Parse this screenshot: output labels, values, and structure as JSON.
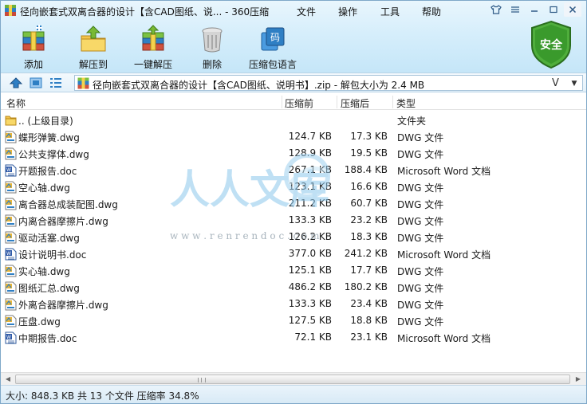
{
  "title": "径向嵌套式双离合器的设计【含CAD图纸、说... - 360压缩",
  "menu": [
    "文件",
    "操作",
    "工具",
    "帮助"
  ],
  "toolbar": [
    {
      "label": "添加",
      "icon": "add-archive-icon"
    },
    {
      "label": "解压到",
      "icon": "extract-to-icon"
    },
    {
      "label": "一键解压",
      "icon": "one-click-extract-icon"
    },
    {
      "label": "删除",
      "icon": "delete-trash-icon"
    },
    {
      "label": "压缩包语言",
      "icon": "archive-language-icon",
      "icon_text": "码"
    }
  ],
  "security_badge": "安全",
  "address": {
    "path": "径向嵌套式双离合器的设计【含CAD图纸、说明书】.zip - 解包大小为 2.4 MB",
    "v_label": "V"
  },
  "columns": {
    "name": "名称",
    "compressed": "压缩前",
    "packed": "压缩后",
    "type": "类型"
  },
  "parent_row": {
    "name": ".. (上级目录)",
    "type": "文件夹"
  },
  "files": [
    {
      "name": "蝶形弹簧.dwg",
      "before": "124.7 KB",
      "after": "17.3 KB",
      "type": "DWG 文件",
      "kind": "dwg"
    },
    {
      "name": "公共支撑体.dwg",
      "before": "128.9 KB",
      "after": "19.5 KB",
      "type": "DWG 文件",
      "kind": "dwg"
    },
    {
      "name": "开题报告.doc",
      "before": "267.1 KB",
      "after": "188.4 KB",
      "type": "Microsoft Word 文档",
      "kind": "doc"
    },
    {
      "name": "空心轴.dwg",
      "before": "123.1 KB",
      "after": "16.6 KB",
      "type": "DWG 文件",
      "kind": "dwg"
    },
    {
      "name": "离合器总成装配图.dwg",
      "before": "211.2 KB",
      "after": "60.7 KB",
      "type": "DWG 文件",
      "kind": "dwg"
    },
    {
      "name": "内离合器摩擦片.dwg",
      "before": "133.3 KB",
      "after": "23.2 KB",
      "type": "DWG 文件",
      "kind": "dwg"
    },
    {
      "name": "驱动活塞.dwg",
      "before": "126.2 KB",
      "after": "18.3 KB",
      "type": "DWG 文件",
      "kind": "dwg"
    },
    {
      "name": "设计说明书.doc",
      "before": "377.0 KB",
      "after": "241.2 KB",
      "type": "Microsoft Word 文档",
      "kind": "doc"
    },
    {
      "name": "实心轴.dwg",
      "before": "125.1 KB",
      "after": "17.7 KB",
      "type": "DWG 文件",
      "kind": "dwg"
    },
    {
      "name": "图纸汇总.dwg",
      "before": "486.2 KB",
      "after": "180.2 KB",
      "type": "DWG 文件",
      "kind": "dwg"
    },
    {
      "name": "外离合器摩擦片.dwg",
      "before": "133.3 KB",
      "after": "23.4 KB",
      "type": "DWG 文件",
      "kind": "dwg"
    },
    {
      "name": "压盘.dwg",
      "before": "127.5 KB",
      "after": "18.8 KB",
      "type": "DWG 文件",
      "kind": "dwg"
    },
    {
      "name": "中期报告.doc",
      "before": "72.1 KB",
      "after": "23.1 KB",
      "type": "Microsoft Word 文档",
      "kind": "doc"
    }
  ],
  "watermark": {
    "big": "人人文库",
    "url": "w w w . r e n r e n d o c . c o m"
  },
  "status": "大小: 848.3 KB 共 13 个文件 压缩率 34.8%",
  "colors": {
    "accent": "#2f7fc4",
    "toolbar_bg": "#d6eefb",
    "safe_green": "#3a9a2c"
  }
}
